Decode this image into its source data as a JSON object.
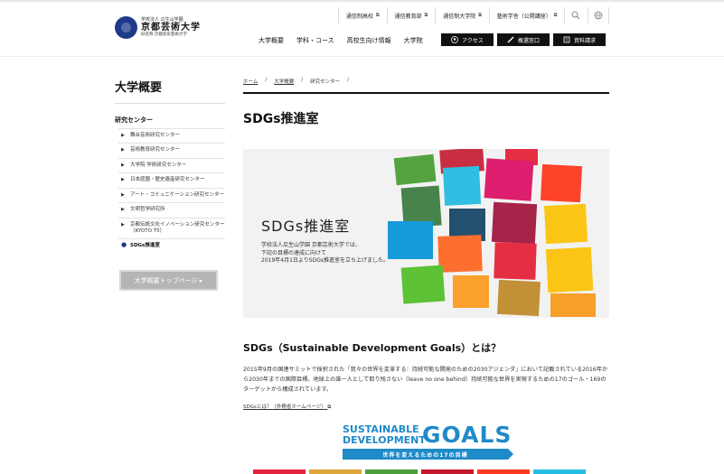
{
  "logo": {
    "sub": "学校法人 瓜生山学園",
    "name": "京都芸術大学",
    "sub2": "旧名称 京都造形芸術大学"
  },
  "util_nav": [
    {
      "label": "通信制高校",
      "icon": "external-link-icon"
    },
    {
      "label": "通信教育部",
      "icon": "external-link-icon"
    },
    {
      "label": "通信制大学院",
      "icon": "external-link-icon"
    },
    {
      "label": "藝術学舎（公開講座）",
      "icon": "external-link-icon"
    }
  ],
  "util_icons": [
    "search-icon",
    "globe-icon"
  ],
  "main_nav": [
    "大学概要",
    "学科・コース",
    "高校生向け情報",
    "大学院"
  ],
  "header_buttons": [
    {
      "label": "アクセス",
      "icon": "pin-icon"
    },
    {
      "label": "概還窓口",
      "icon": "pencil-icon"
    },
    {
      "label": "資料請求",
      "icon": "document-icon"
    }
  ],
  "sidebar": {
    "title": "大学概要",
    "section": "研究センター",
    "items": [
      {
        "label": "舞台芸術研究センター",
        "active": false
      },
      {
        "label": "芸術教育研究センター",
        "active": false
      },
      {
        "label": "大学院 学術研究センター",
        "active": false
      },
      {
        "label": "日本庭園・歴史遺産研究センター",
        "active": false
      },
      {
        "label": "アート・コミュニケーション研究センター",
        "active": false
      },
      {
        "label": "文明哲学研究所",
        "active": false
      },
      {
        "label": "京都伝統文化イノベーション研究センター（KYOTO T5）",
        "active": false
      },
      {
        "label": "SDGs推進室",
        "active": true
      }
    ],
    "top_button": "大学概要トップページ ▸"
  },
  "breadcrumb": [
    "ホーム",
    "大学概要",
    "研究センター"
  ],
  "page_title": "SDGs推進室",
  "hero": {
    "heading": "SDGs推進室",
    "lines": [
      "学校法人瓜生山学園 京都芸術大学では、",
      "下記の目標の達成に向けて",
      "2019年4月1日よりSDGs推進室を立ち上げました。"
    ]
  },
  "section_heading": "SDGs（Sustainable Development Goals）とは？",
  "paragraph": "2015年9月の国連サミットで採択された「我々の世界を変革する：持続可能な開発のための2030アジェンダ」において記載されている2016年から2030年までの国際目標。地球上の誰一人として取り残さない（leave no one behind）持続可能な世界を実現するための17のゴール・169のターゲットから構成されています。",
  "external_link": "SDGsとは？（外務省ホームページ）",
  "goals_logo": {
    "line1": "SUSTAINABLE",
    "line2": "DEVELOPMENT",
    "big": "GOALS",
    "band": "世界を変えるための17の目標"
  },
  "colors": {
    "brand": "#1d3a8a",
    "sdg_blue": "#1f8ac8",
    "button_gray": "#b5b5b5"
  }
}
